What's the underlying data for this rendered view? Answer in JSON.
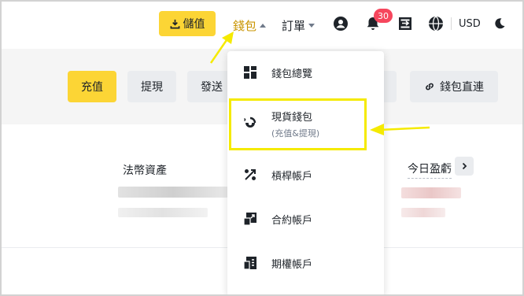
{
  "header": {
    "deposit_label": "儲值",
    "wallet_label": "錢包",
    "orders_label": "訂單",
    "notification_count": "30",
    "currency": "USD"
  },
  "actions": {
    "deposit": "充值",
    "withdraw": "提現",
    "send": "發送",
    "wallet_connect": "錢包直連"
  },
  "content": {
    "fiat_assets_label": "法幣資產",
    "today_pnl_label": "今日盈虧"
  },
  "wallet_menu": {
    "items": [
      {
        "label": "錢包總覽",
        "sub": "",
        "icon": "dashboard-icon"
      },
      {
        "label": "現貨錢包",
        "sub": "(充值&提現)",
        "icon": "spot-wallet-icon"
      },
      {
        "label": "槓桿帳戶",
        "sub": "",
        "icon": "margin-icon"
      },
      {
        "label": "合約帳戶",
        "sub": "",
        "icon": "futures-icon"
      },
      {
        "label": "期權帳戶",
        "sub": "",
        "icon": "options-icon"
      }
    ]
  },
  "colors": {
    "accent": "#fcd535",
    "wallet_active": "#c99400",
    "badge": "#f6465d",
    "highlight_box": "#f5ea00"
  }
}
